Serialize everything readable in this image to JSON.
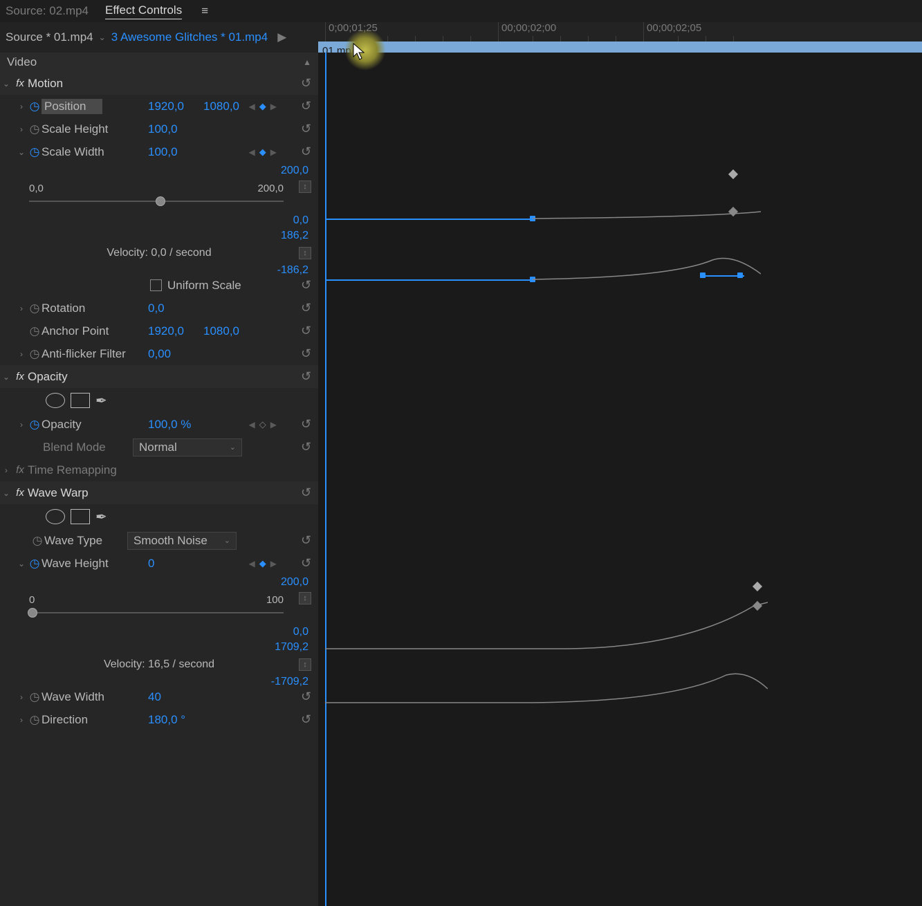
{
  "tabs": {
    "source": "Source: 02.mp4",
    "effect": "Effect Controls"
  },
  "crumb": {
    "a": "Source * 01.mp4",
    "b": "3 Awesome Glitches * 01.mp4"
  },
  "timeline": {
    "clip": "01.mp4",
    "t1": "0;00;01;25",
    "t2": "00;00;02;00",
    "t3": "00;00;02;05"
  },
  "header": {
    "video": "Video"
  },
  "motion": {
    "title": "Motion",
    "position": {
      "label": "Position",
      "x": "1920,0",
      "y": "1080,0"
    },
    "scaleHeight": {
      "label": "Scale Height",
      "v": "100,0"
    },
    "scaleWidth": {
      "label": "Scale Width",
      "v": "100,0",
      "min": "0,0",
      "max": "200,0",
      "gmax": "200,0",
      "gzero": "0,0",
      "vmax": "186,2",
      "vmin": "-186,2",
      "velocity": "Velocity: 0,0 / second"
    },
    "uniform": "Uniform Scale",
    "rotation": {
      "label": "Rotation",
      "v": "0,0"
    },
    "anchor": {
      "label": "Anchor Point",
      "x": "1920,0",
      "y": "1080,0"
    },
    "antiflicker": {
      "label": "Anti-flicker Filter",
      "v": "0,00"
    }
  },
  "opacity": {
    "title": "Opacity",
    "opacity": {
      "label": "Opacity",
      "v": "100,0 %"
    },
    "blend": {
      "label": "Blend Mode",
      "v": "Normal"
    }
  },
  "timeremap": {
    "title": "Time Remapping"
  },
  "wave": {
    "title": "Wave Warp",
    "type": {
      "label": "Wave Type",
      "v": "Smooth Noise"
    },
    "height": {
      "label": "Wave Height",
      "v": "0",
      "min": "0",
      "max": "100",
      "gmax": "200,0",
      "gzero": "0,0",
      "vmax": "1709,2",
      "vmin": "-1709,2",
      "velocity": "Velocity: 16,5 / second"
    },
    "width": {
      "label": "Wave Width",
      "v": "40"
    },
    "direction": {
      "label": "Direction",
      "v": "180,0 °"
    }
  }
}
